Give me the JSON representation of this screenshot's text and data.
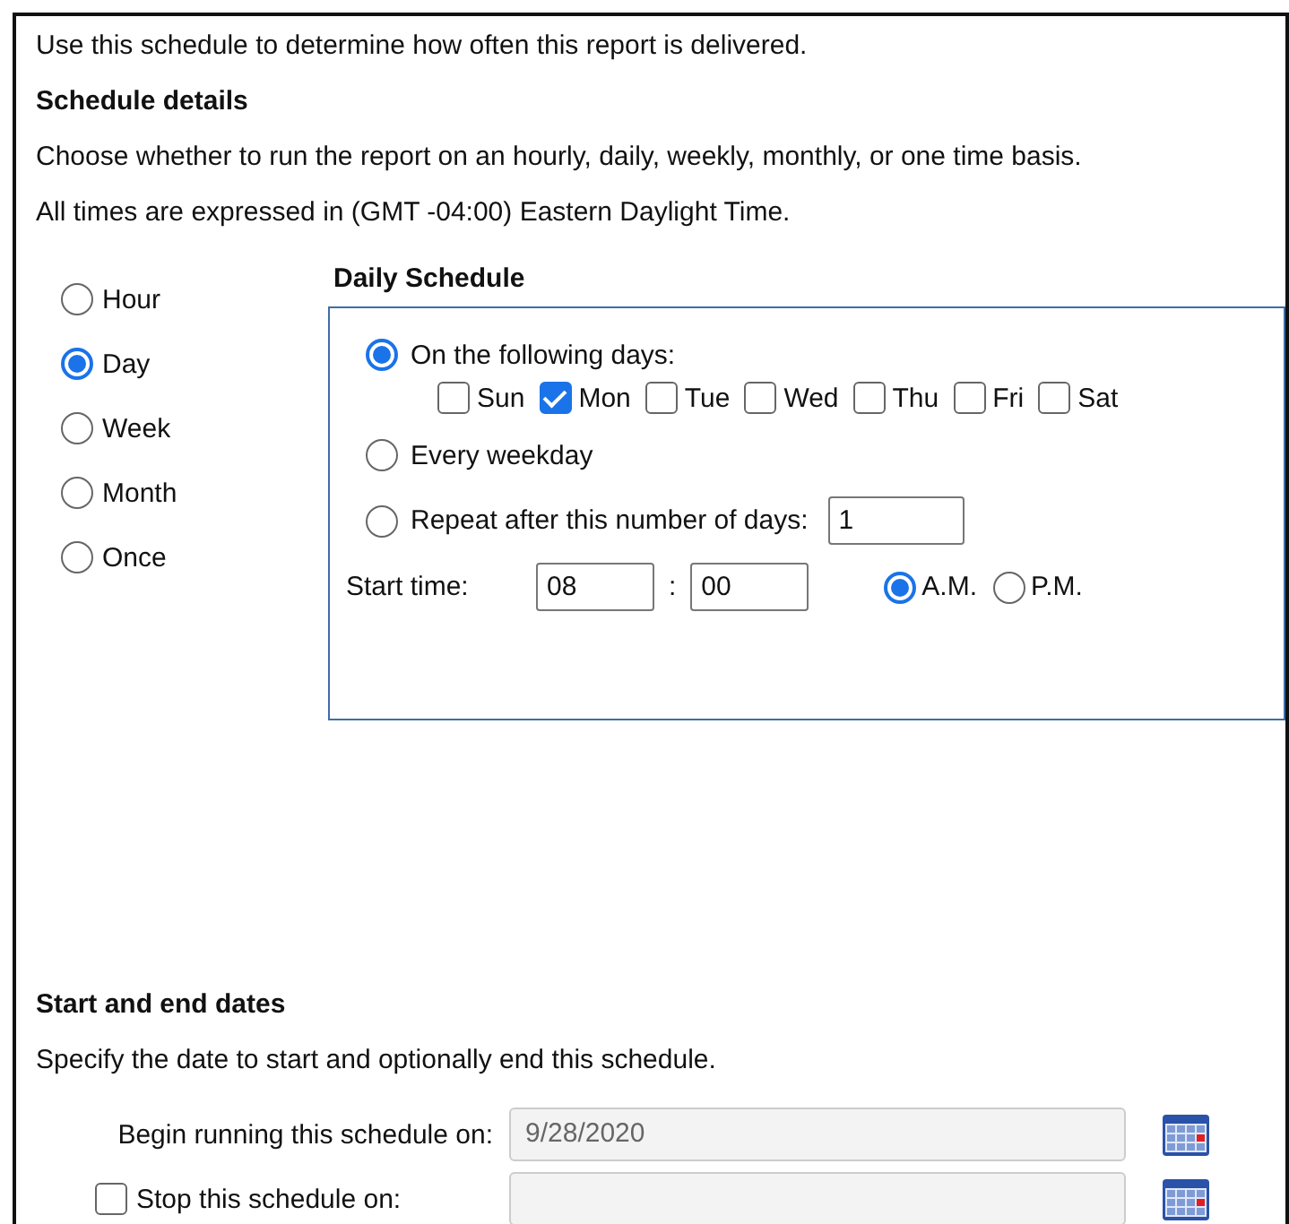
{
  "intro": "Use this schedule to determine how often this report is delivered.",
  "schedule_details": {
    "heading": "Schedule details",
    "lines": [
      "Choose whether to run the report on an hourly, daily, weekly, monthly, or one time basis.",
      "All times are expressed in (GMT -04:00) Eastern Daylight Time."
    ]
  },
  "frequency": [
    {
      "label": "Hour",
      "selected": false
    },
    {
      "label": "Day",
      "selected": true
    },
    {
      "label": "Week",
      "selected": false
    },
    {
      "label": "Month",
      "selected": false
    },
    {
      "label": "Once",
      "selected": false
    }
  ],
  "daily": {
    "title": "Daily Schedule",
    "options": [
      {
        "kind": "days",
        "label": "On the following days:",
        "selected": true,
        "days": [
          {
            "label": "Sun",
            "checked": false
          },
          {
            "label": "Mon",
            "checked": true
          },
          {
            "label": "Tue",
            "checked": false
          },
          {
            "label": "Wed",
            "checked": false
          },
          {
            "label": "Thu",
            "checked": false
          },
          {
            "label": "Fri",
            "checked": false
          },
          {
            "label": "Sat",
            "checked": false
          }
        ]
      },
      {
        "kind": "plain",
        "label": "Every weekday",
        "selected": false
      },
      {
        "kind": "repeat",
        "label": "Repeat after this number of days:",
        "selected": false,
        "value": "1"
      }
    ],
    "start_time": {
      "label": "Start time:",
      "hour": "08",
      "separator": ":",
      "minute": "00",
      "periods": [
        {
          "label": "A.M.",
          "selected": true
        },
        {
          "label": "P.M.",
          "selected": false
        }
      ]
    }
  },
  "dates": {
    "heading": "Start and end dates",
    "description": "Specify the date to start and optionally end this schedule.",
    "begin": {
      "label": "Begin running this schedule on:",
      "value": "9/28/2020"
    },
    "stop": {
      "label": "Stop this schedule on:",
      "checked": false
    }
  }
}
